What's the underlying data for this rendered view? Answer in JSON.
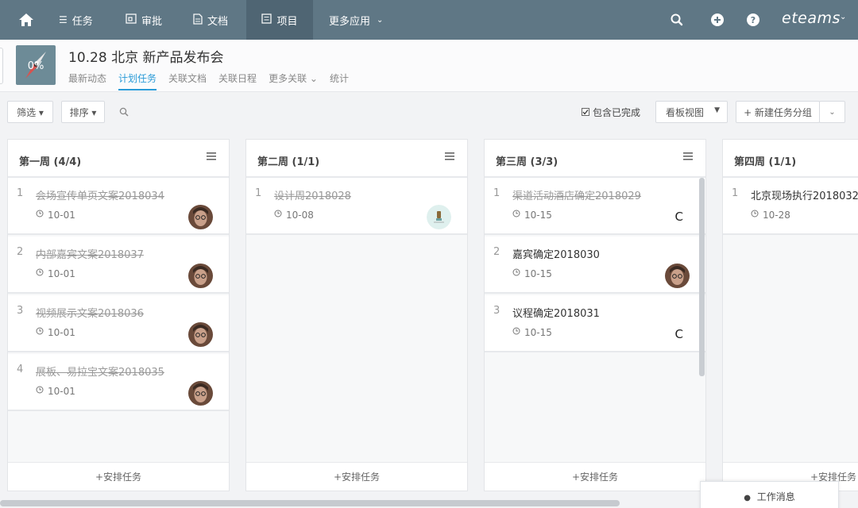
{
  "nav": {
    "items": [
      {
        "icon": "list-icon",
        "label": "任务"
      },
      {
        "icon": "approval-icon",
        "label": "审批"
      },
      {
        "icon": "document-icon",
        "label": "文档"
      },
      {
        "icon": "project-icon",
        "label": "项目"
      },
      {
        "icon": "",
        "label": "更多应用"
      }
    ],
    "brand": "eteams"
  },
  "project": {
    "logo_text": "0%",
    "title": "10.28 北京 新产品发布会",
    "tabs": [
      "最新动态",
      "计划任务",
      "关联文档",
      "关联日程",
      "更多关联 ⌄",
      "统计"
    ],
    "active_tab": "计划任务"
  },
  "toolbar": {
    "filter": "筛选 ▾",
    "sort": "排序 ▾",
    "include_done": "包含已完成",
    "view": "看板视图",
    "new_group": "+ 新建任务分组"
  },
  "columns": [
    {
      "title": "第一周 (4/4)",
      "footer": "+安排任务",
      "cards": [
        {
          "num": "1",
          "name": "会场宣传单页文案2018034",
          "done": true,
          "date": "10-01",
          "assignee": "avatar"
        },
        {
          "num": "2",
          "name": "内部嘉宾文案2018037",
          "done": true,
          "date": "10-01",
          "assignee": "avatar"
        },
        {
          "num": "3",
          "name": "视频展示文案2018036",
          "done": true,
          "date": "10-01",
          "assignee": "avatar"
        },
        {
          "num": "4",
          "name": "展板、易拉宝文案2018035",
          "done": true,
          "date": "10-01",
          "assignee": "avatar"
        }
      ]
    },
    {
      "title": "第二周 (1/1)",
      "footer": "+安排任务",
      "cards": [
        {
          "num": "1",
          "name": "设计周2018028",
          "done": true,
          "date": "10-08",
          "assignee": "logo-avatar"
        }
      ]
    },
    {
      "title": "第三周 (3/3)",
      "footer": "+安排任务",
      "cards": [
        {
          "num": "1",
          "name": "渠道活动酒店确定2018029",
          "done": true,
          "date": "10-15",
          "assignee": "C"
        },
        {
          "num": "2",
          "name": "嘉宾确定2018030",
          "done": false,
          "date": "10-15",
          "assignee": "avatar"
        },
        {
          "num": "3",
          "name": "议程确定2018031",
          "done": false,
          "date": "10-15",
          "assignee": "C"
        }
      ]
    },
    {
      "title": "第四周 (1/1)",
      "footer": "+安排任务",
      "cards": [
        {
          "num": "1",
          "name": "北京现场执行2018032",
          "done": false,
          "date": "10-28",
          "assignee": ""
        }
      ]
    }
  ],
  "work_message": "工作消息"
}
